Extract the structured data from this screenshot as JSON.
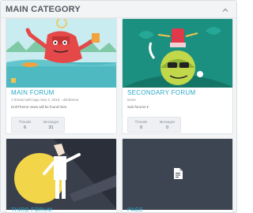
{
  "category": {
    "title": "MAIN CATEGORY"
  },
  "forums": [
    {
      "title": "MAIN FORUM",
      "meta": "A thread with tags  Sep 4, 2018 · dohtheme",
      "desc": "DohTheme news will be found here",
      "stats": [
        {
          "label": "Threads",
          "value": "6"
        },
        {
          "label": "Messages",
          "value": "31"
        }
      ]
    },
    {
      "title": "SECONDARY FORUM",
      "meta": "None",
      "desc": "Sub-forums ▾",
      "stats": [
        {
          "label": "Threads",
          "value": "0"
        },
        {
          "label": "Messages",
          "value": "0"
        }
      ]
    },
    {
      "title": "THIRD FORUM"
    },
    {
      "title": "PAGE"
    }
  ],
  "icons": {
    "collapse": "chevron-up-icon",
    "page": "document-icon"
  }
}
